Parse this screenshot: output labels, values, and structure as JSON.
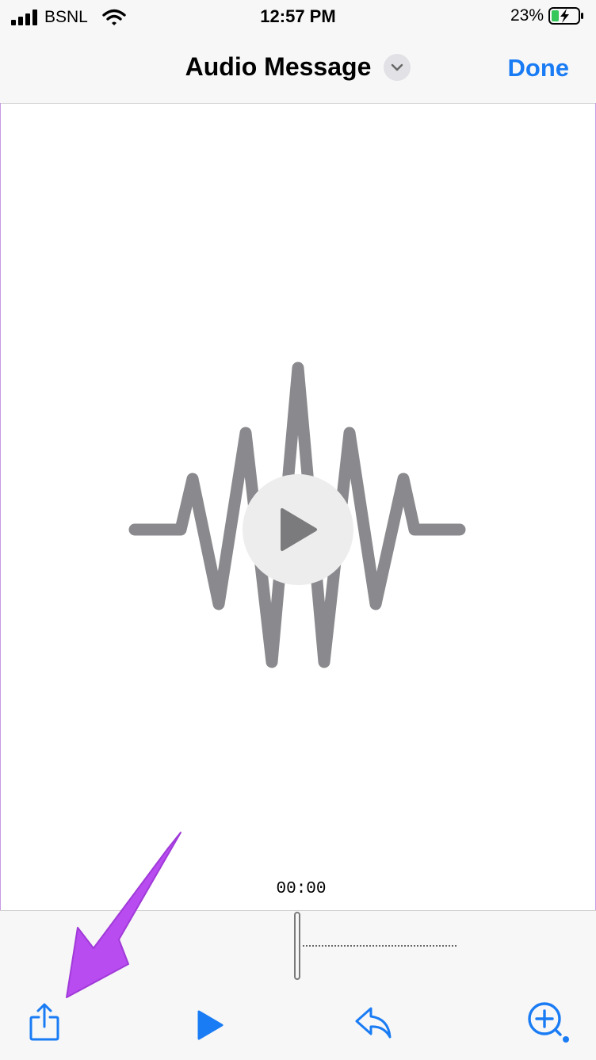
{
  "status_bar": {
    "carrier": "BSNL",
    "time": "12:57 PM",
    "battery": "23%"
  },
  "nav": {
    "title": "Audio Message",
    "done_label": "Done"
  },
  "player": {
    "timestamp": "00:00"
  },
  "colors": {
    "accent": "#1a7cf4",
    "waveform": "#8a8a8e",
    "annotation": "#b94cf0",
    "battery": "#35c759"
  },
  "icons": {
    "share": "share-icon",
    "play": "play-icon",
    "reply": "reply-icon",
    "add": "add-circle-icon"
  }
}
